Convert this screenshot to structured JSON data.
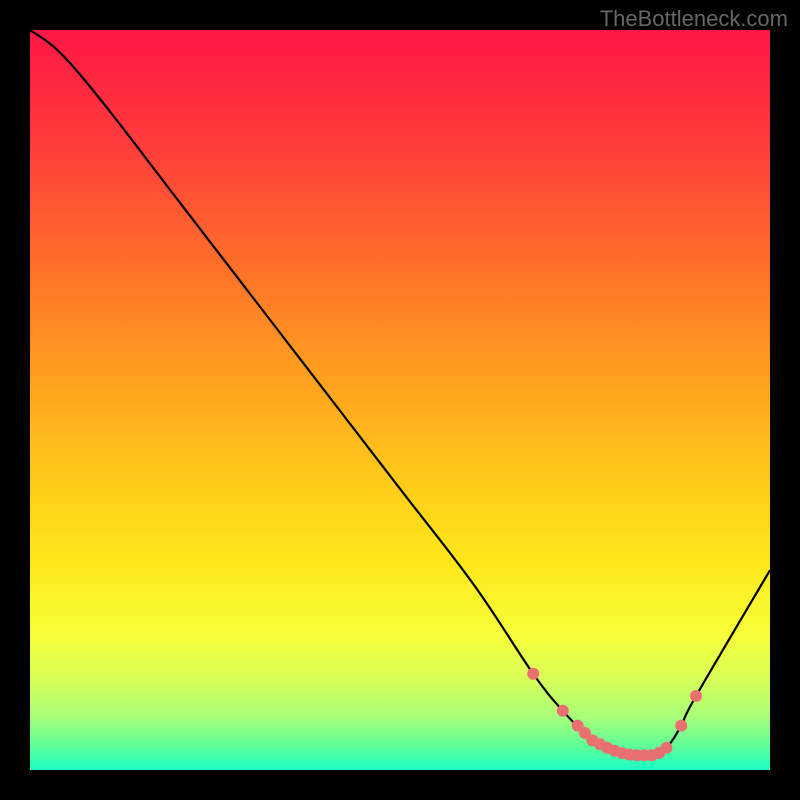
{
  "watermark": "TheBottleneck.com",
  "chart_data": {
    "type": "line",
    "title": "",
    "xlabel": "",
    "ylabel": "",
    "xlim": [
      0,
      100
    ],
    "ylim": [
      0,
      100
    ],
    "series": [
      {
        "name": "bottleneck-curve",
        "x": [
          0,
          4,
          10,
          20,
          30,
          40,
          50,
          60,
          68,
          72,
          75,
          78,
          80,
          82,
          84,
          86,
          88,
          90,
          100
        ],
        "values": [
          100,
          97,
          90,
          77,
          64,
          51,
          38,
          25,
          13,
          8,
          5,
          3,
          2,
          2,
          2,
          3,
          6,
          10,
          27
        ]
      }
    ],
    "markers": {
      "name": "highlighted-points",
      "color": "#e97070",
      "x": [
        68,
        72,
        74,
        75,
        76,
        77,
        78,
        79,
        80,
        81,
        82,
        83,
        84,
        85,
        86,
        88,
        90
      ],
      "values": [
        13,
        8,
        6,
        5,
        4,
        3.5,
        3,
        2.6,
        2.3,
        2.1,
        2,
        2,
        2,
        2.3,
        3,
        6,
        10
      ]
    },
    "gradient_stops": [
      {
        "offset": 0.0,
        "color": "#ff1744"
      },
      {
        "offset": 0.15,
        "color": "#ff3b3b"
      },
      {
        "offset": 0.3,
        "color": "#ff6a2a"
      },
      {
        "offset": 0.45,
        "color": "#ff9a1f"
      },
      {
        "offset": 0.6,
        "color": "#ffc81a"
      },
      {
        "offset": 0.72,
        "color": "#ffe81a"
      },
      {
        "offset": 0.82,
        "color": "#f6ff3a"
      },
      {
        "offset": 0.88,
        "color": "#d6ff5a"
      },
      {
        "offset": 0.93,
        "color": "#a6ff7a"
      },
      {
        "offset": 0.97,
        "color": "#5aff9a"
      },
      {
        "offset": 1.0,
        "color": "#1affc8"
      }
    ]
  }
}
